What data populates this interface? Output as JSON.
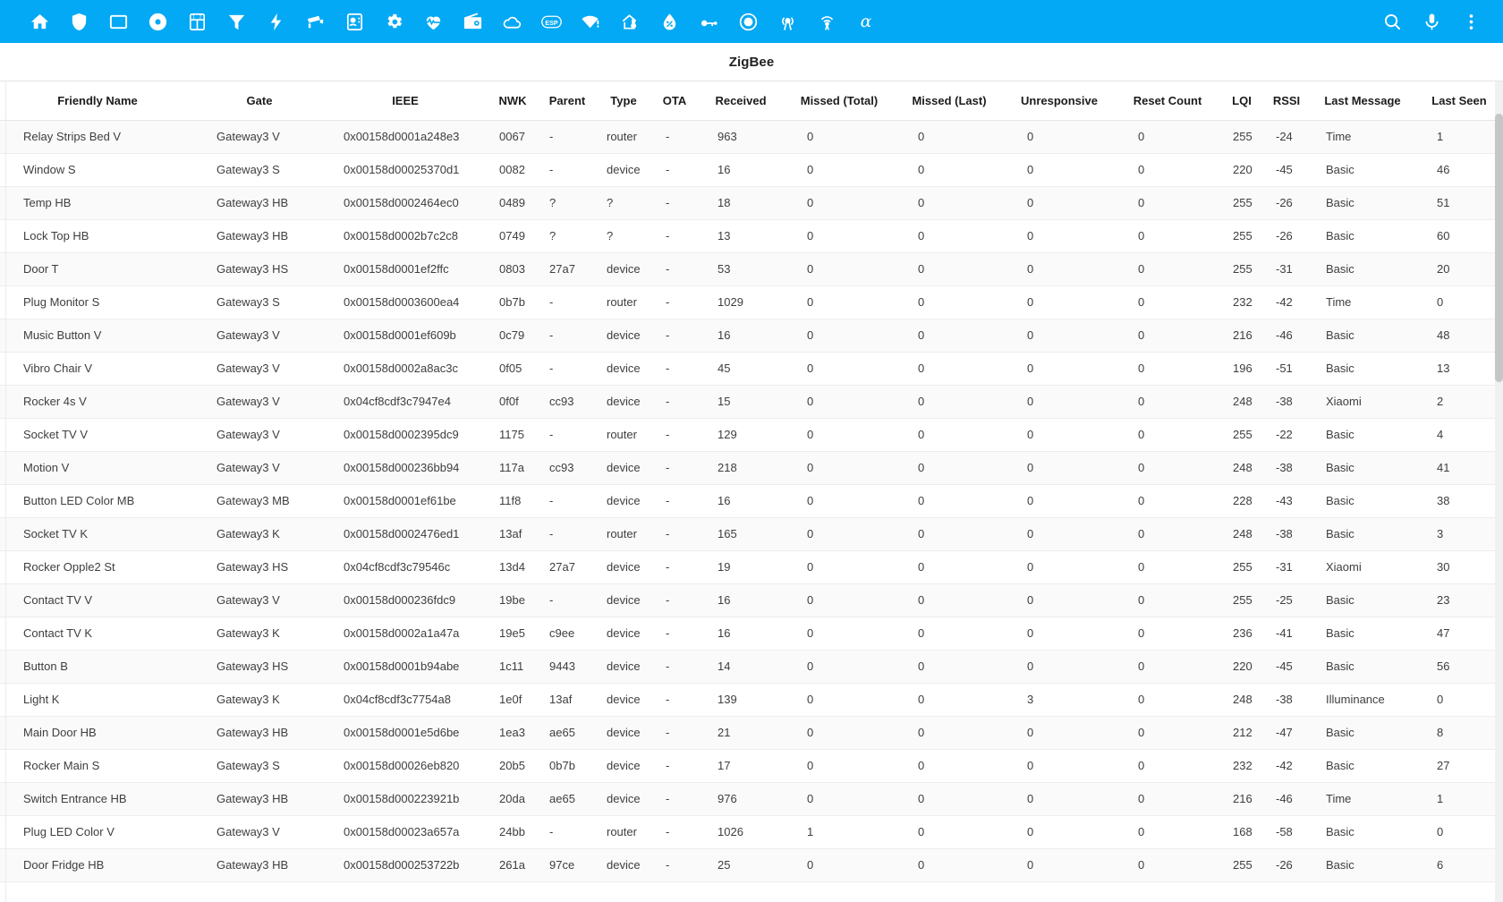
{
  "appbar": {
    "background": "#03a9f4",
    "icons": [
      {
        "name": "home-icon",
        "label": "Home"
      },
      {
        "name": "shield-icon",
        "label": "Security"
      },
      {
        "name": "tv-icon",
        "label": "Media"
      },
      {
        "name": "disc-icon",
        "label": "Vacuum"
      },
      {
        "name": "calculator-icon",
        "label": "Meters"
      },
      {
        "name": "funnel-icon",
        "label": "Filters"
      },
      {
        "name": "lightning-bolt-icon",
        "label": "Energy"
      },
      {
        "name": "cctv-camera-icon",
        "label": "Cameras"
      },
      {
        "name": "contact-card-icon",
        "label": "Contacts"
      },
      {
        "name": "gear-icon",
        "label": "Settings"
      },
      {
        "name": "heart-pulse-icon",
        "label": "Health"
      },
      {
        "name": "radio-icon",
        "label": "Radio"
      },
      {
        "name": "cloud-icon",
        "label": "Weather"
      },
      {
        "name": "esp-badge-icon",
        "label": "ESP"
      },
      {
        "name": "wifi-alert-icon",
        "label": "WiFi"
      },
      {
        "name": "home-thermometer-icon",
        "label": "Climate"
      },
      {
        "name": "water-percent-icon",
        "label": "Humidity"
      },
      {
        "name": "key-link-icon",
        "label": "Access"
      },
      {
        "name": "record-circle-icon",
        "label": "Record"
      },
      {
        "name": "broadcast-icon",
        "label": "Broadcast"
      },
      {
        "name": "antenna-tower-icon",
        "label": "ZigBee"
      }
    ],
    "alpha_label": "α",
    "right_icons": [
      {
        "name": "search-icon",
        "label": "Search"
      },
      {
        "name": "microphone-icon",
        "label": "Assist"
      },
      {
        "name": "overflow-menu-icon",
        "label": "More options"
      }
    ]
  },
  "header": {
    "title": "ZigBee"
  },
  "table": {
    "columns": [
      {
        "key": "friendly_name",
        "label": "Friendly Name"
      },
      {
        "key": "gate",
        "label": "Gate"
      },
      {
        "key": "ieee",
        "label": "IEEE"
      },
      {
        "key": "nwk",
        "label": "NWK"
      },
      {
        "key": "parent",
        "label": "Parent"
      },
      {
        "key": "type",
        "label": "Type"
      },
      {
        "key": "ota",
        "label": "OTA"
      },
      {
        "key": "received",
        "label": "Received"
      },
      {
        "key": "missed_total",
        "label": "Missed (Total)"
      },
      {
        "key": "missed_last",
        "label": "Missed (Last)"
      },
      {
        "key": "unresponsive",
        "label": "Unresponsive"
      },
      {
        "key": "reset_count",
        "label": "Reset Count"
      },
      {
        "key": "lqi",
        "label": "LQI"
      },
      {
        "key": "rssi",
        "label": "RSSI"
      },
      {
        "key": "last_message",
        "label": "Last Message"
      },
      {
        "key": "last_seen",
        "label": "Last Seen"
      }
    ],
    "rows": [
      [
        "Relay Strips Bed V",
        "Gateway3 V",
        "0x00158d0001a248e3",
        "0067",
        "-",
        "router",
        "-",
        "963",
        "0",
        "0",
        "0",
        "0",
        "255",
        "-24",
        "Time",
        "1"
      ],
      [
        "Window S",
        "Gateway3 S",
        "0x00158d00025370d1",
        "0082",
        "-",
        "device",
        "-",
        "16",
        "0",
        "0",
        "0",
        "0",
        "220",
        "-45",
        "Basic",
        "46"
      ],
      [
        "Temp HB",
        "Gateway3 HB",
        "0x00158d0002464ec0",
        "0489",
        "?",
        "?",
        "-",
        "18",
        "0",
        "0",
        "0",
        "0",
        "255",
        "-26",
        "Basic",
        "51"
      ],
      [
        "Lock Top HB",
        "Gateway3 HB",
        "0x00158d0002b7c2c8",
        "0749",
        "?",
        "?",
        "-",
        "13",
        "0",
        "0",
        "0",
        "0",
        "255",
        "-26",
        "Basic",
        "60"
      ],
      [
        "Door T",
        "Gateway3 HS",
        "0x00158d0001ef2ffc",
        "0803",
        "27a7",
        "device",
        "-",
        "53",
        "0",
        "0",
        "0",
        "0",
        "255",
        "-31",
        "Basic",
        "20"
      ],
      [
        "Plug Monitor S",
        "Gateway3 S",
        "0x00158d0003600ea4",
        "0b7b",
        "-",
        "router",
        "-",
        "1029",
        "0",
        "0",
        "0",
        "0",
        "232",
        "-42",
        "Time",
        "0"
      ],
      [
        "Music Button V",
        "Gateway3 V",
        "0x00158d0001ef609b",
        "0c79",
        "-",
        "device",
        "-",
        "16",
        "0",
        "0",
        "0",
        "0",
        "216",
        "-46",
        "Basic",
        "48"
      ],
      [
        "Vibro Chair V",
        "Gateway3 V",
        "0x00158d0002a8ac3c",
        "0f05",
        "-",
        "device",
        "-",
        "45",
        "0",
        "0",
        "0",
        "0",
        "196",
        "-51",
        "Basic",
        "13"
      ],
      [
        "Rocker 4s V",
        "Gateway3 V",
        "0x04cf8cdf3c7947e4",
        "0f0f",
        "cc93",
        "device",
        "-",
        "15",
        "0",
        "0",
        "0",
        "0",
        "248",
        "-38",
        "Xiaomi",
        "2"
      ],
      [
        "Socket TV V",
        "Gateway3 V",
        "0x00158d0002395dc9",
        "1175",
        "-",
        "router",
        "-",
        "129",
        "0",
        "0",
        "0",
        "0",
        "255",
        "-22",
        "Basic",
        "4"
      ],
      [
        "Motion V",
        "Gateway3 V",
        "0x00158d000236bb94",
        "117a",
        "cc93",
        "device",
        "-",
        "218",
        "0",
        "0",
        "0",
        "0",
        "248",
        "-38",
        "Basic",
        "41"
      ],
      [
        "Button LED Color MB",
        "Gateway3 MB",
        "0x00158d0001ef61be",
        "11f8",
        "-",
        "device",
        "-",
        "16",
        "0",
        "0",
        "0",
        "0",
        "228",
        "-43",
        "Basic",
        "38"
      ],
      [
        "Socket TV K",
        "Gateway3 K",
        "0x00158d0002476ed1",
        "13af",
        "-",
        "router",
        "-",
        "165",
        "0",
        "0",
        "0",
        "0",
        "248",
        "-38",
        "Basic",
        "3"
      ],
      [
        "Rocker Opple2 St",
        "Gateway3 HS",
        "0x04cf8cdf3c79546c",
        "13d4",
        "27a7",
        "device",
        "-",
        "19",
        "0",
        "0",
        "0",
        "0",
        "255",
        "-31",
        "Xiaomi",
        "30"
      ],
      [
        "Contact TV V",
        "Gateway3 V",
        "0x00158d000236fdc9",
        "19be",
        "-",
        "device",
        "-",
        "16",
        "0",
        "0",
        "0",
        "0",
        "255",
        "-25",
        "Basic",
        "23"
      ],
      [
        "Contact TV K",
        "Gateway3 K",
        "0x00158d0002a1a47a",
        "19e5",
        "c9ee",
        "device",
        "-",
        "16",
        "0",
        "0",
        "0",
        "0",
        "236",
        "-41",
        "Basic",
        "47"
      ],
      [
        "Button B",
        "Gateway3 HS",
        "0x00158d0001b94abe",
        "1c11",
        "9443",
        "device",
        "-",
        "14",
        "0",
        "0",
        "0",
        "0",
        "220",
        "-45",
        "Basic",
        "56"
      ],
      [
        "Light K",
        "Gateway3 K",
        "0x04cf8cdf3c7754a8",
        "1e0f",
        "13af",
        "device",
        "-",
        "139",
        "0",
        "0",
        "3",
        "0",
        "248",
        "-38",
        "Illuminance",
        "0"
      ],
      [
        "Main Door HB",
        "Gateway3 HB",
        "0x00158d0001e5d6be",
        "1ea3",
        "ae65",
        "device",
        "-",
        "21",
        "0",
        "0",
        "0",
        "0",
        "212",
        "-47",
        "Basic",
        "8"
      ],
      [
        "Rocker Main S",
        "Gateway3 S",
        "0x00158d00026eb820",
        "20b5",
        "0b7b",
        "device",
        "-",
        "17",
        "0",
        "0",
        "0",
        "0",
        "232",
        "-42",
        "Basic",
        "27"
      ],
      [
        "Switch Entrance HB",
        "Gateway3 HB",
        "0x00158d000223921b",
        "20da",
        "ae65",
        "device",
        "-",
        "976",
        "0",
        "0",
        "0",
        "0",
        "216",
        "-46",
        "Time",
        "1"
      ],
      [
        "Plug LED Color V",
        "Gateway3 V",
        "0x00158d00023a657a",
        "24bb",
        "-",
        "router",
        "-",
        "1026",
        "1",
        "0",
        "0",
        "0",
        "168",
        "-58",
        "Basic",
        "0"
      ],
      [
        "Door Fridge HB",
        "Gateway3 HB",
        "0x00158d000253722b",
        "261a",
        "97ce",
        "device",
        "-",
        "25",
        "0",
        "0",
        "0",
        "0",
        "255",
        "-26",
        "Basic",
        "6"
      ]
    ]
  }
}
